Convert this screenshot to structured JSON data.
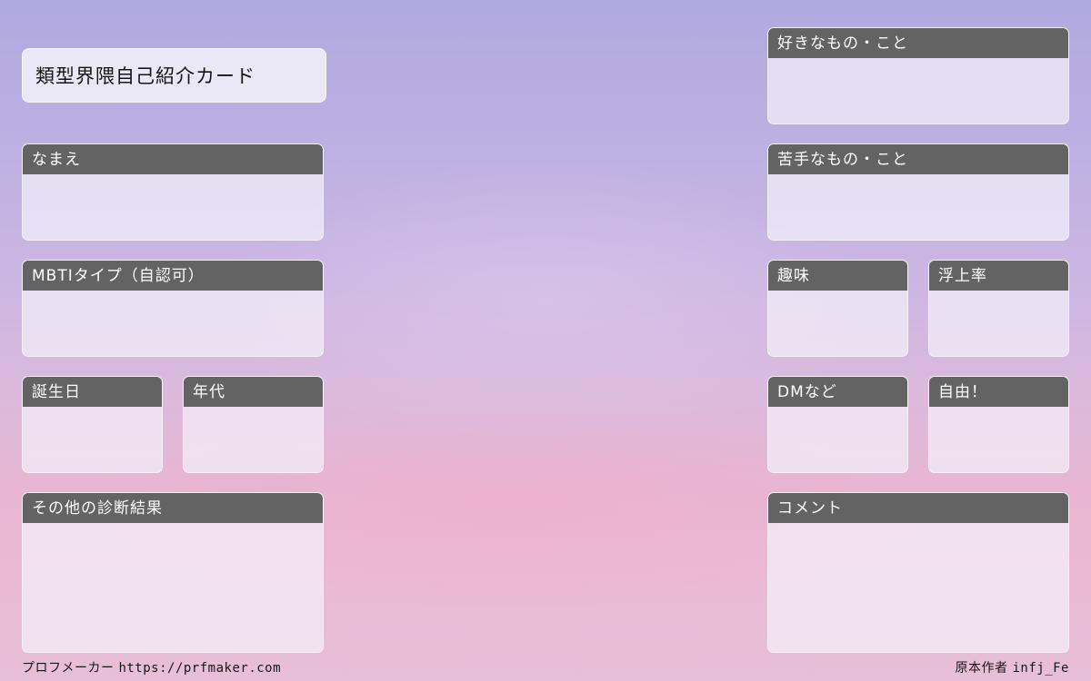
{
  "card": {
    "title": "類型界隈自己紹介カード"
  },
  "fields": {
    "name": "なまえ",
    "mbti": "MBTIタイプ（自認可）",
    "birthday": "誕生日",
    "age_group": "年代",
    "other_results": "その他の診断結果",
    "likes": "好きなもの・こと",
    "dislikes": "苦手なもの・こと",
    "hobbies": "趣味",
    "online_rate": "浮上率",
    "dm": "DMなど",
    "free": "自由！",
    "comment": "コメント"
  },
  "footer": {
    "maker_label": "プロフメーカー",
    "maker_url": "https://prfmaker.com",
    "author_label": "原本作者",
    "author_name": "infj_Fe"
  }
}
